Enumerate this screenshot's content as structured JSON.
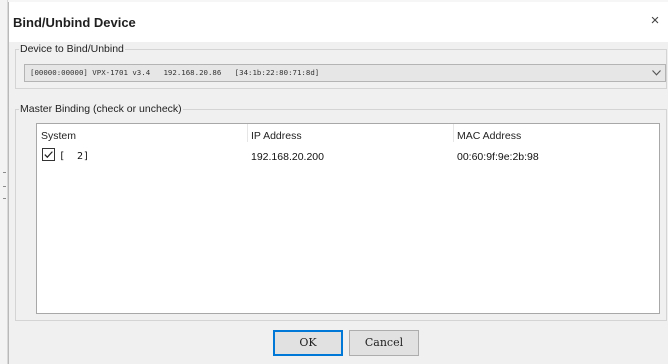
{
  "dialog": {
    "title": "Bind/Unbind Device",
    "close_glyph": "×"
  },
  "device_group": {
    "label": "Device to Bind/Unbind",
    "selected_value": "[00000:00000] VPX-1701 v3.4   192.168.20.86   [34:1b:22:80:71:8d]",
    "dropdown_icon": "chevron-down-icon"
  },
  "master_group": {
    "label": "Master Binding (check or uncheck)",
    "columns": [
      "System",
      "IP Address",
      "MAC Address"
    ],
    "rows": [
      {
        "checked": true,
        "system": "[  2]",
        "ip": "192.168.20.200",
        "mac": "00:60:9f:9e:2b:98"
      }
    ]
  },
  "buttons": {
    "ok_label": "OK",
    "cancel_label": "Cancel"
  },
  "colors": {
    "dialog_bg": "#f0f0f0",
    "titlebar_bg": "#ffffff",
    "default_button_border": "#0078d7"
  }
}
